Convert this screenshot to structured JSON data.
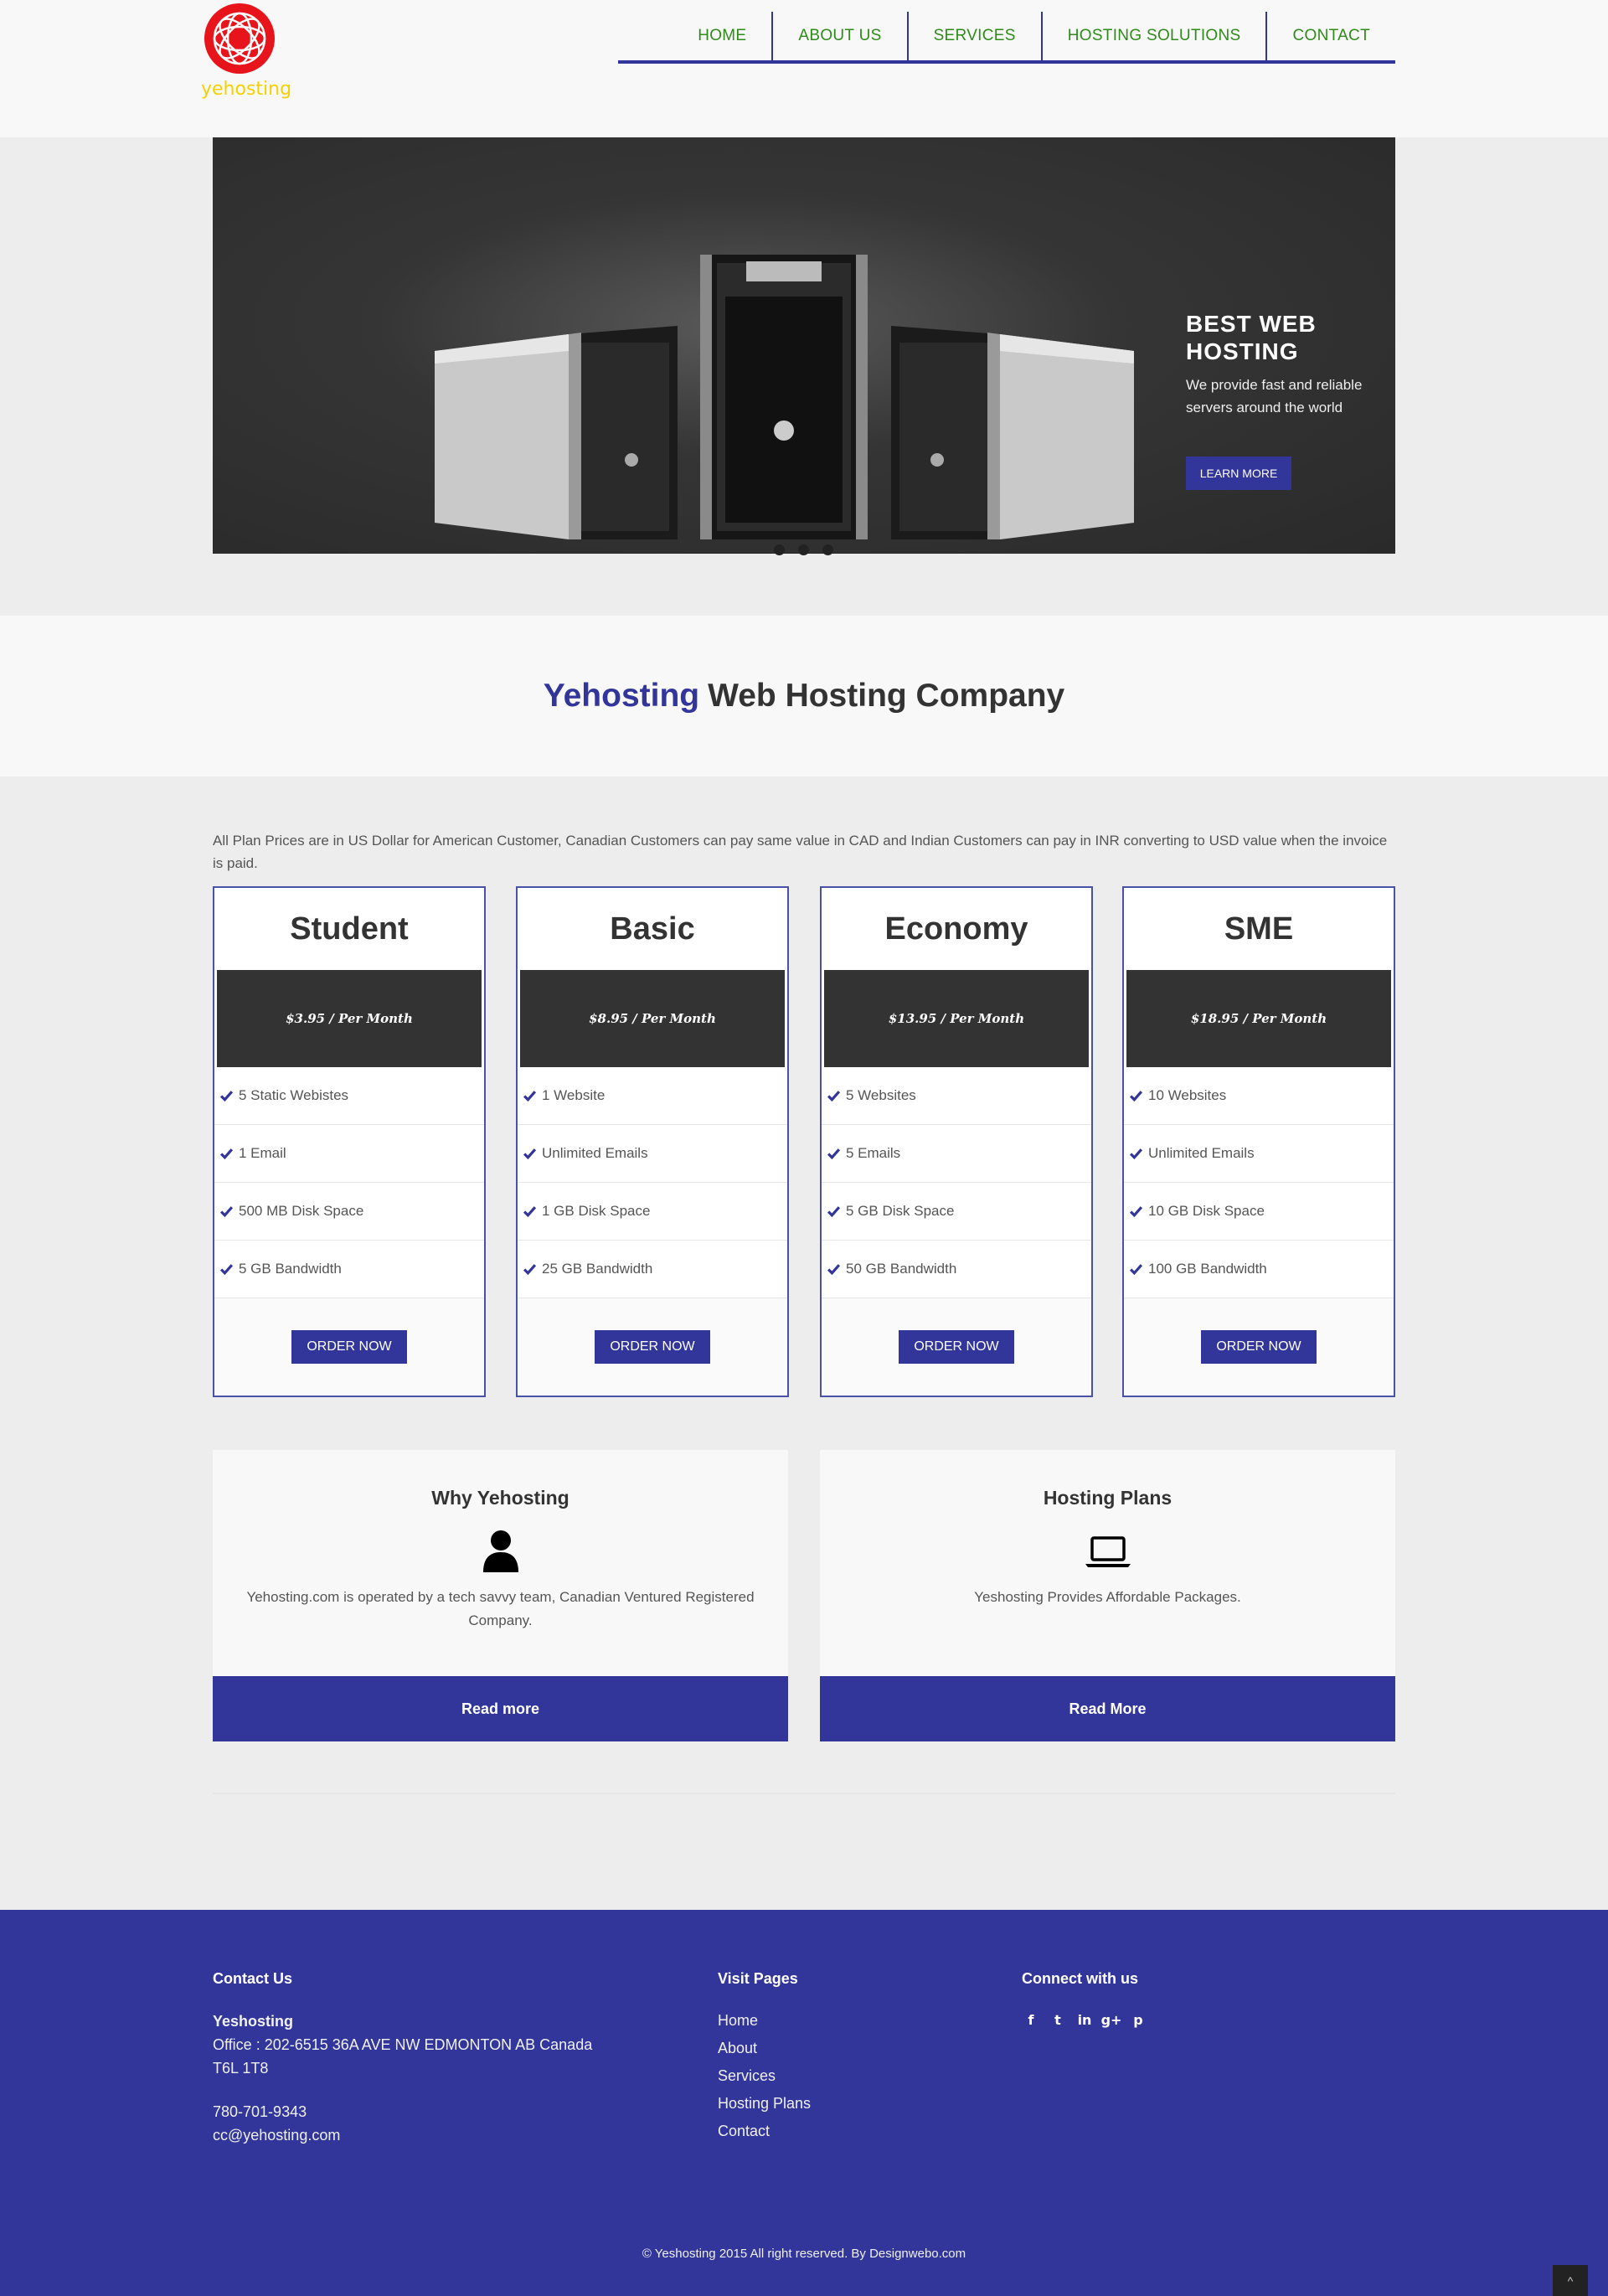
{
  "header": {
    "logo_text": "yehosting",
    "nav": [
      "HOME",
      "ABOUT US",
      "SERVICES",
      "HOSTING SOLUTIONS",
      "CONTACT"
    ]
  },
  "slider": {
    "title": "BEST WEB HOSTING",
    "text": "We provide fast and reliable servers around the world",
    "button": "LEARN MORE",
    "slides_count": 3
  },
  "band": {
    "brand": "Yehosting",
    "rest": "Web Hosting Company"
  },
  "pricing": {
    "note": "All Plan Prices are in US Dollar for American Customer, Canadian Customers can pay same value in CAD and Indian Customers can pay in INR converting to USD value when the invoice is paid.",
    "plans": [
      {
        "name": "Student",
        "price": "$3.95 / Per Month",
        "features": [
          "5 Static Webistes",
          "1 Email",
          "500 MB Disk Space",
          "5 GB Bandwidth"
        ],
        "button": "ORDER NOW"
      },
      {
        "name": "Basic",
        "price": "$8.95 / Per Month",
        "features": [
          "1 Website",
          "Unlimited Emails",
          "1 GB Disk Space",
          "25 GB Bandwidth"
        ],
        "button": "ORDER NOW"
      },
      {
        "name": "Economy",
        "price": "$13.95 / Per Month",
        "features": [
          "5 Websites",
          "5 Emails",
          "5 GB Disk Space",
          "50 GB Bandwidth"
        ],
        "button": "ORDER NOW"
      },
      {
        "name": "SME",
        "price": "$18.95 / Per Month",
        "features": [
          "10 Websites",
          "Unlimited Emails",
          "10 GB Disk Space",
          "100 GB Bandwidth"
        ],
        "button": "ORDER NOW"
      }
    ]
  },
  "info": [
    {
      "title": "Why Yehosting",
      "icon": "user-icon",
      "text": "Yehosting.com is operated by a tech savvy team, Canadian Ventured Registered Company.",
      "button": "Read more"
    },
    {
      "title": "Hosting Plans",
      "icon": "laptop-icon",
      "text": "Yeshosting Provides Affordable Packages.",
      "button": "Read More"
    }
  ],
  "footer": {
    "contact_heading": "Contact Us",
    "company": "Yeshosting",
    "address_line1": "Office : 202-6515 36A AVE NW EDMONTON AB Canada",
    "address_line2": "T6L 1T8",
    "phone": "780-701-9343",
    "email": "cc@yehosting.com",
    "visit_heading": "Visit Pages",
    "links": [
      "Home",
      "About",
      "Services",
      "Hosting Plans",
      "Contact"
    ],
    "connect_heading": "Connect with us",
    "socials": [
      {
        "icon": "facebook-icon",
        "glyph": "f"
      },
      {
        "icon": "twitter-icon",
        "glyph": "t"
      },
      {
        "icon": "linkedin-icon",
        "glyph": "in"
      },
      {
        "icon": "google-plus-icon",
        "glyph": "g+"
      },
      {
        "icon": "pinterest-icon",
        "glyph": "p"
      }
    ],
    "copyright": "© Yeshosting 2015 All right reserved. By Designwebo.com",
    "to_top_glyph": "^"
  },
  "colors": {
    "primary": "#32359a",
    "nav_text": "#2e8b1a",
    "logo_red": "#e8141c",
    "logo_yellow": "#f5d100",
    "price_bg": "#333333"
  }
}
